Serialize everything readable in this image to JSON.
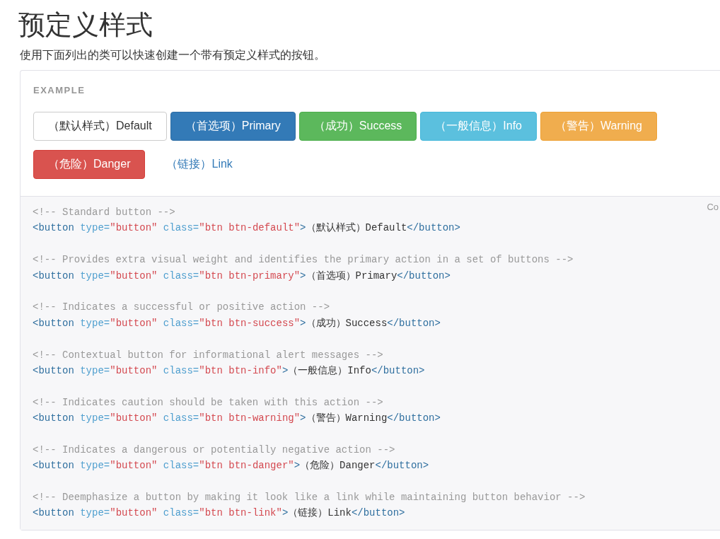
{
  "heading": "预定义样式",
  "intro": "使用下面列出的类可以快速创建一个带有预定义样式的按钮。",
  "example": {
    "label": "EXAMPLE",
    "buttons": [
      {
        "label": "（默认样式）Default",
        "kind": "default"
      },
      {
        "label": "（首选项）Primary",
        "kind": "primary"
      },
      {
        "label": "（成功）Success",
        "kind": "success"
      },
      {
        "label": "（一般信息）Info",
        "kind": "info"
      },
      {
        "label": "（警告）Warning",
        "kind": "warning"
      },
      {
        "label": "（危险）Danger",
        "kind": "danger"
      },
      {
        "label": "（链接）Link",
        "kind": "link"
      }
    ]
  },
  "code": {
    "copy_label": "Co",
    "blocks": [
      {
        "comment": "<!-- Standard button -->",
        "tokens": [
          {
            "kind": "tag",
            "text": "<button "
          },
          {
            "kind": "attr",
            "text": "type="
          },
          {
            "kind": "string",
            "text": "\"button\""
          },
          {
            "kind": "attr",
            "text": " class="
          },
          {
            "kind": "string",
            "text": "\"btn btn-default\""
          },
          {
            "kind": "tag",
            "text": ">"
          },
          {
            "kind": "plain",
            "text": "（默认样式）Default"
          },
          {
            "kind": "tag",
            "text": "</button>"
          }
        ]
      },
      {
        "comment": "<!-- Provides extra visual weight and identifies the primary action in a set of buttons -->",
        "tokens": [
          {
            "kind": "tag",
            "text": "<button "
          },
          {
            "kind": "attr",
            "text": "type="
          },
          {
            "kind": "string",
            "text": "\"button\""
          },
          {
            "kind": "attr",
            "text": " class="
          },
          {
            "kind": "string",
            "text": "\"btn btn-primary\""
          },
          {
            "kind": "tag",
            "text": ">"
          },
          {
            "kind": "plain",
            "text": "（首选项）Primary"
          },
          {
            "kind": "tag",
            "text": "</button>"
          }
        ]
      },
      {
        "comment": "<!-- Indicates a successful or positive action -->",
        "tokens": [
          {
            "kind": "tag",
            "text": "<button "
          },
          {
            "kind": "attr",
            "text": "type="
          },
          {
            "kind": "string",
            "text": "\"button\""
          },
          {
            "kind": "attr",
            "text": " class="
          },
          {
            "kind": "string",
            "text": "\"btn btn-success\""
          },
          {
            "kind": "tag",
            "text": ">"
          },
          {
            "kind": "plain",
            "text": "（成功）Success"
          },
          {
            "kind": "tag",
            "text": "</button>"
          }
        ]
      },
      {
        "comment": "<!-- Contextual button for informational alert messages -->",
        "tokens": [
          {
            "kind": "tag",
            "text": "<button "
          },
          {
            "kind": "attr",
            "text": "type="
          },
          {
            "kind": "string",
            "text": "\"button\""
          },
          {
            "kind": "attr",
            "text": " class="
          },
          {
            "kind": "string",
            "text": "\"btn btn-info\""
          },
          {
            "kind": "tag",
            "text": ">"
          },
          {
            "kind": "plain",
            "text": "（一般信息）Info"
          },
          {
            "kind": "tag",
            "text": "</button>"
          }
        ]
      },
      {
        "comment": "<!-- Indicates caution should be taken with this action -->",
        "tokens": [
          {
            "kind": "tag",
            "text": "<button "
          },
          {
            "kind": "attr",
            "text": "type="
          },
          {
            "kind": "string",
            "text": "\"button\""
          },
          {
            "kind": "attr",
            "text": " class="
          },
          {
            "kind": "string",
            "text": "\"btn btn-warning\""
          },
          {
            "kind": "tag",
            "text": ">"
          },
          {
            "kind": "plain",
            "text": "（警告）Warning"
          },
          {
            "kind": "tag",
            "text": "</button>"
          }
        ]
      },
      {
        "comment": "<!-- Indicates a dangerous or potentially negative action -->",
        "tokens": [
          {
            "kind": "tag",
            "text": "<button "
          },
          {
            "kind": "attr",
            "text": "type="
          },
          {
            "kind": "string",
            "text": "\"button\""
          },
          {
            "kind": "attr",
            "text": " class="
          },
          {
            "kind": "string",
            "text": "\"btn btn-danger\""
          },
          {
            "kind": "tag",
            "text": ">"
          },
          {
            "kind": "plain",
            "text": "（危险）Danger"
          },
          {
            "kind": "tag",
            "text": "</button>"
          }
        ]
      },
      {
        "comment": "<!-- Deemphasize a button by making it look like a link while maintaining button behavior -->",
        "tokens": [
          {
            "kind": "tag",
            "text": "<button "
          },
          {
            "kind": "attr",
            "text": "type="
          },
          {
            "kind": "string",
            "text": "\"button\""
          },
          {
            "kind": "attr",
            "text": " class="
          },
          {
            "kind": "string",
            "text": "\"btn btn-link\""
          },
          {
            "kind": "tag",
            "text": ">"
          },
          {
            "kind": "plain",
            "text": "（链接）Link"
          },
          {
            "kind": "tag",
            "text": "</button>"
          }
        ]
      }
    ]
  }
}
